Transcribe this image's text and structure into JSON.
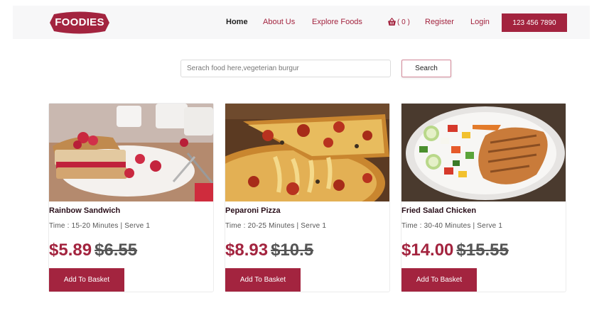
{
  "brand": {
    "logo_text": "FOODIES",
    "accent": "#a3243f"
  },
  "nav": {
    "links": [
      {
        "label": "Home",
        "active": true
      },
      {
        "label": "About Us",
        "active": false
      },
      {
        "label": "Explore Foods",
        "active": false
      }
    ],
    "cart_icon": "basket-icon",
    "cart_count": "( 0 )",
    "register": "Register",
    "login": "Login",
    "phone": "123 456 7890"
  },
  "search": {
    "placeholder": "Serach food here,vegeterian burgur",
    "button_label": "Search"
  },
  "products": [
    {
      "name": "Rainbow Sandwich",
      "meta": "Time : 15-20 Minutes | Serve 1",
      "price": "$5.89",
      "old_price": "$6.55",
      "button": "Add To Basket"
    },
    {
      "name": "Peparoni Pizza",
      "meta": "Time : 20-25 Minutes | Serve 1",
      "price": "$8.93",
      "old_price": "$10.5",
      "button": "Add To Basket"
    },
    {
      "name": "Fried Salad Chicken",
      "meta": "Time : 30-40 Minutes | Serve 1",
      "price": "$14.00",
      "old_price": "$15.55",
      "button": "Add To Basket"
    }
  ]
}
